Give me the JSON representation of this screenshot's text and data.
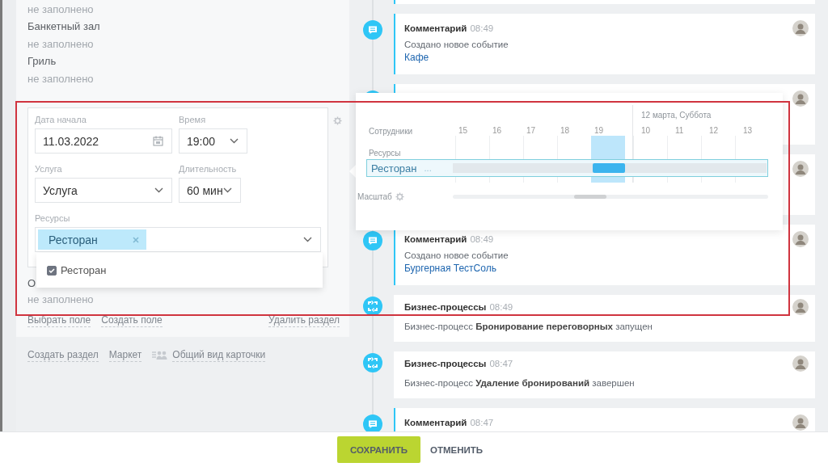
{
  "left_panel": {
    "lines": [
      {
        "kind": "value",
        "text": "не заполнено"
      },
      {
        "kind": "label",
        "text": "Банкетный зал"
      },
      {
        "kind": "value",
        "text": "не заполнено"
      },
      {
        "kind": "label",
        "text": "Гриль"
      },
      {
        "kind": "value",
        "text": "не заполнено"
      }
    ],
    "booking_form": {
      "start_date": {
        "label": "Дата начала",
        "value": "11.03.2022"
      },
      "time": {
        "label": "Время",
        "value": "19:00"
      },
      "service": {
        "label": "Услуга",
        "value": "Услуга"
      },
      "duration": {
        "label": "Длительность",
        "value": "60 мин"
      },
      "resources": {
        "label": "Ресурсы",
        "tags": [
          "Ресторан"
        ]
      },
      "resource_options": [
        {
          "label": "Ресторан",
          "checked": true
        }
      ]
    },
    "lines_after": [
      {
        "kind": "label",
        "text": "О"
      },
      {
        "kind": "value",
        "text": "не заполнено"
      }
    ],
    "field_actions": [
      "Выбрать поле",
      "Создать поле"
    ],
    "delete_section": "Удалить раздел"
  },
  "section_links": [
    {
      "kind": "link",
      "text": "Создать раздел"
    },
    {
      "kind": "link",
      "text": "Маркет"
    },
    {
      "kind": "icon_link",
      "text": "Общий вид карточки"
    }
  ],
  "timeline_popup": {
    "staff_label": "Сотрудники",
    "resources_label": "Ресурсы",
    "scale_label": "Масштаб",
    "days": [
      {
        "hours": [
          {
            "label": "15",
            "highlighted": false,
            "booked": false
          },
          {
            "label": "16",
            "highlighted": false,
            "booked": false
          },
          {
            "label": "17",
            "highlighted": false,
            "booked": false
          },
          {
            "label": "18",
            "highlighted": false,
            "booked": false
          },
          {
            "label": "19",
            "highlighted": true,
            "booked": true
          }
        ]
      },
      {
        "date": "12 марта, Суббота",
        "hours": [
          {
            "label": "10",
            "highlighted": false,
            "booked": false
          },
          {
            "label": "11",
            "highlighted": false,
            "booked": false
          },
          {
            "label": "12",
            "highlighted": false,
            "booked": false
          },
          {
            "label": "13",
            "highlighted": false,
            "booked": false
          }
        ]
      }
    ],
    "resources": [
      {
        "name": "Ресторан",
        "more": "..."
      }
    ]
  },
  "feed": [
    {
      "kind": "cut"
    },
    {
      "kind": "comment",
      "title": "Комментарий",
      "time": "08:49",
      "text": "Создано новое событие",
      "link": "Кафе"
    },
    {
      "kind": "comment"
    },
    {
      "kind": "covered"
    },
    {
      "kind": "comment",
      "title": "Комментарий",
      "time": "08:49",
      "text": "Создано новое событие",
      "link": "Бургерная ТестСоль"
    },
    {
      "kind": "process",
      "title": "Бизнес-процессы",
      "time": "08:49",
      "text": "Бизнес-процесс **Бронирование переговорных** запущен"
    },
    {
      "kind": "process",
      "title": "Бизнес-процессы",
      "time": "08:47",
      "text": "Бизнес-процесс **Удаление бронирований** завершен"
    },
    {
      "kind": "comment",
      "title": "Комментарий",
      "time": "08:47"
    }
  ],
  "footer": {
    "buttons": [
      {
        "kind": "primary",
        "label": "СОХРАНИТЬ"
      },
      {
        "kind": "plain",
        "label": "ОТМЕНИТЬ"
      }
    ]
  }
}
